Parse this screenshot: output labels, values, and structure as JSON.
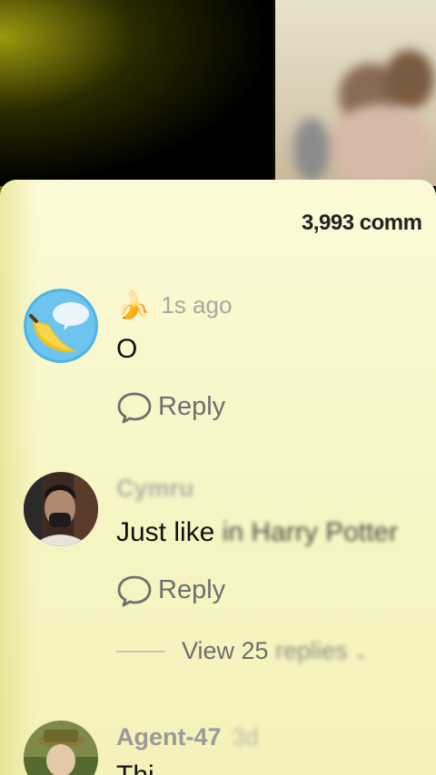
{
  "comments_header": {
    "count_label": "3,993 comm"
  },
  "comments": [
    {
      "author_icon": "banana-emoji",
      "author_glyph": "🍌",
      "time": "1s ago",
      "text": "O",
      "reply_label": "Reply"
    },
    {
      "author": "Cymru",
      "text_visible": "Just like ",
      "text_blurred": "in Harry Potter",
      "reply_label": "Reply",
      "view_replies_visible": "View 25 ",
      "view_replies_blurred": "replies"
    },
    {
      "author": "Agent-47",
      "time": "3d",
      "text_partial": "Thi"
    }
  ],
  "colors": {
    "sheet_background": "#f8f6c8",
    "text_primary": "#111111",
    "text_secondary": "#6e6e6e"
  }
}
